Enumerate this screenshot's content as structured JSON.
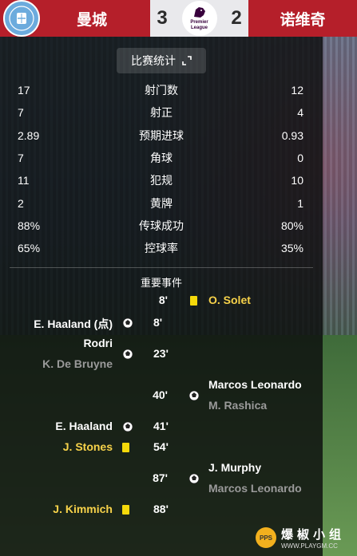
{
  "header": {
    "home_team": "曼城",
    "away_team": "诺维奇",
    "home_score": "3",
    "away_score": "2",
    "league_logo_text": "Premier League",
    "home_crest_text": "MANCHESTER CITY"
  },
  "panel": {
    "title": "比赛统计",
    "expand_icon": "expand-icon"
  },
  "stats": [
    {
      "home": "17",
      "label": "射门数",
      "away": "12"
    },
    {
      "home": "7",
      "label": "射正",
      "away": "4"
    },
    {
      "home": "2.89",
      "label": "预期进球",
      "away": "0.93"
    },
    {
      "home": "7",
      "label": "角球",
      "away": "0"
    },
    {
      "home": "11",
      "label": "犯规",
      "away": "10"
    },
    {
      "home": "2",
      "label": "黄牌",
      "away": "1"
    },
    {
      "home": "88%",
      "label": "传球成功",
      "away": "80%"
    },
    {
      "home": "65%",
      "label": "控球率",
      "away": "35%"
    }
  ],
  "events_title": "重要事件",
  "events": [
    {
      "minute": "8'",
      "side": "away",
      "type": "yellow-card",
      "player": "O. Solet"
    },
    {
      "minute": "8'",
      "side": "home",
      "type": "goal",
      "player": "E. Haaland (点)"
    },
    {
      "minute": "23'",
      "side": "home",
      "type": "goal",
      "player": "Rodri",
      "assist": "K. De Bruyne"
    },
    {
      "minute": "40'",
      "side": "away",
      "type": "goal",
      "player": "Marcos Leonardo",
      "assist": "M. Rashica"
    },
    {
      "minute": "41'",
      "side": "home",
      "type": "goal",
      "player": "E. Haaland"
    },
    {
      "minute": "54'",
      "side": "home",
      "type": "yellow-card",
      "player": "J. Stones"
    },
    {
      "minute": "87'",
      "side": "away",
      "type": "goal",
      "player": "J. Murphy",
      "assist": "Marcos Leonardo"
    },
    {
      "minute": "88'",
      "side": "home",
      "type": "yellow-card",
      "player": "J. Kimmich"
    }
  ],
  "watermark": {
    "badge": "PPS",
    "main": "爆椒小组",
    "sub": "WWW.PLAYGM.CC"
  },
  "colors": {
    "header_red": "#b51f2a",
    "panel_bg": "#0c0e0e",
    "yellow_card": "#f5d90a",
    "highlight_gold": "#f7d24a"
  }
}
